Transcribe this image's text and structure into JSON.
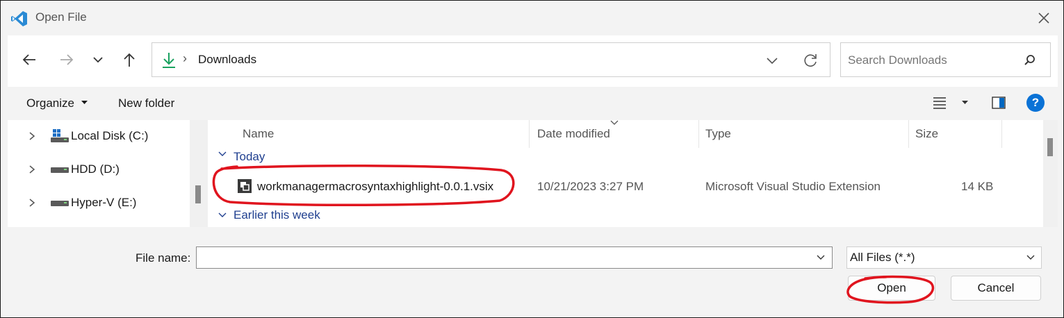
{
  "window": {
    "title": "Open File",
    "app_icon": "vscode-icon",
    "close_icon": "close-icon"
  },
  "navigation": {
    "back_icon": "arrow-left-icon",
    "forward_icon": "arrow-right-icon",
    "recent_icon": "chevron-down-icon",
    "up_icon": "arrow-up-icon",
    "address": {
      "location_icon": "download-icon",
      "separator": "›",
      "path": "Downloads"
    },
    "search": {
      "placeholder": "Search Downloads",
      "icon": "search-icon"
    }
  },
  "toolbar": {
    "organize_label": "Organize",
    "new_folder_label": "New folder",
    "view_icon": "list-view-icon",
    "preview_icon": "preview-pane-icon",
    "help_icon": "help-icon",
    "help_glyph": "?"
  },
  "sidebar": {
    "items": [
      {
        "label": "Local Disk (C:)",
        "icon": "windows-drive-icon"
      },
      {
        "label": "HDD (D:)",
        "icon": "drive-icon"
      },
      {
        "label": "Hyper-V (E:)",
        "icon": "drive-icon"
      }
    ]
  },
  "file_list": {
    "columns": [
      "Name",
      "Date modified",
      "Type",
      "Size"
    ],
    "groups": [
      {
        "label": "Today",
        "files": [
          {
            "name": "workmanagermacrosyntaxhighlight-0.0.1.vsix",
            "date_modified": "10/21/2023 3:27 PM",
            "type": "Microsoft Visual Studio Extension",
            "size": "14 KB",
            "icon": "vsix-file-icon"
          }
        ]
      },
      {
        "label": "Earlier this week",
        "files": []
      }
    ]
  },
  "footer": {
    "file_name_label": "File name:",
    "file_name_value": "",
    "filter_value": "All Files (*.*)",
    "open_label": "Open",
    "cancel_label": "Cancel"
  },
  "colors": {
    "annotation_red": "#e0141e",
    "accent_blue": "#0067c0",
    "download_green": "#1aa260"
  }
}
